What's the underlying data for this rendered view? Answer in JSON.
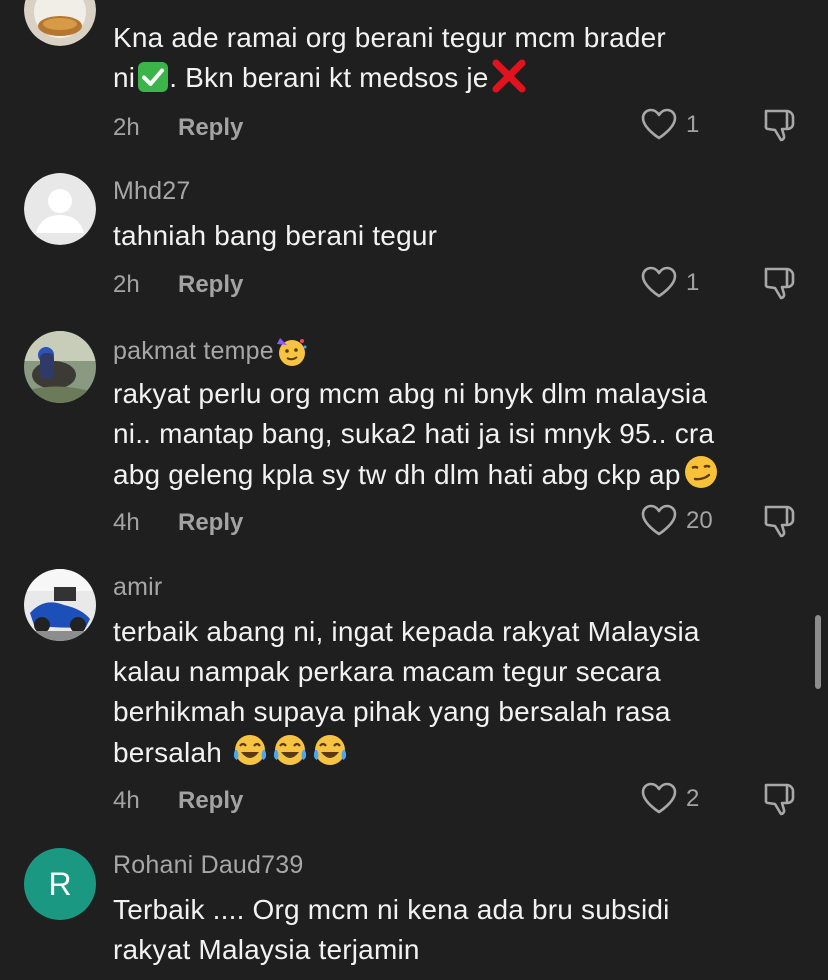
{
  "comments": [
    {
      "username": "",
      "lines": [
        "Kna ade ramai org berani tegur mcm brader",
        "ni",
        ". Bkn berani kt medsos je"
      ],
      "emojis": [
        "check-mark-emoji",
        "cross-mark-emoji"
      ],
      "time": "2h",
      "reply": "Reply",
      "likes": "1"
    },
    {
      "username": "Mhd27",
      "lines": [
        "tahniah bang berani tegur"
      ],
      "time": "2h",
      "reply": "Reply",
      "likes": "1"
    },
    {
      "username": "pakmat tempe",
      "username_emoji": "partying-face-emoji",
      "lines": [
        "rakyat perlu org mcm abg ni bnyk dlm malaysia",
        "ni.. mantap bang, suka2 hati ja isi mnyk 95.. cra",
        "abg geleng kpla sy tw dh dlm hati abg ckp ap"
      ],
      "line_emoji": "smirking-face-emoji",
      "time": "4h",
      "reply": "Reply",
      "likes": "20"
    },
    {
      "username": "amir",
      "lines": [
        "terbaik abang ni, ingat kepada rakyat Malaysia",
        "kalau nampak perkara macam tegur secara",
        "berhikmah supaya pihak yang bersalah rasa",
        "bersalah"
      ],
      "line_emoji": "tears-of-joy-emoji",
      "time": "4h",
      "reply": "Reply",
      "likes": "2"
    },
    {
      "username": "Rohani Daud739",
      "avatar_letter": "R",
      "lines": [
        "Terbaik .... Org mcm ni kena ada bru subsidi",
        "rakyat Malaysia terjamin"
      ]
    }
  ],
  "colors": {
    "background": "#1f1f1f",
    "username": "#a7a7a7",
    "text": "#f2f2f2",
    "meta": "#a3a3a3",
    "avatar_teal": "#1a9882"
  },
  "icons": {
    "like": "heart-outline-icon",
    "dislike": "thumbs-down-outline-icon",
    "default_avatar": "person-silhouette-icon"
  }
}
